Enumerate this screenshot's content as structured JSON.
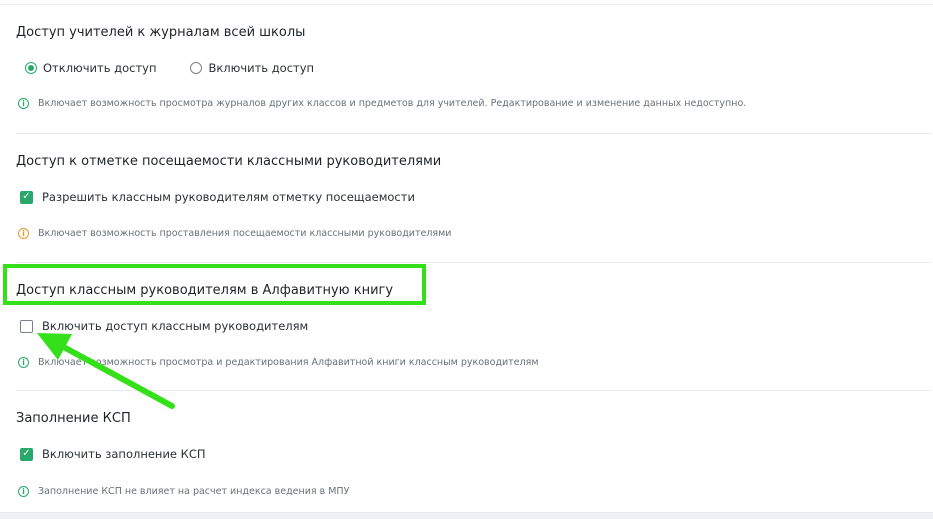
{
  "sections": [
    {
      "title": "Доступ учителей к журналам всей школы",
      "options": [
        {
          "label": "Отключить доступ",
          "selected": true
        },
        {
          "label": "Включить доступ",
          "selected": false
        }
      ],
      "hint": "Включает возможность просмотра журналов других классов и предметов для учителей. Редактирование и изменение данных недоступно.",
      "hint_icon": "info-icon"
    },
    {
      "title": "Доступ к отметке посещаемости классными руководителями",
      "checkbox": {
        "label": "Разрешить классным руководителям отметку посещаемости",
        "checked": true
      },
      "hint": "Включает возможность проставления посещаемости классными руководителями",
      "hint_icon": "warning-icon"
    },
    {
      "title": "Доступ классным руководителям в Алфавитную книгу",
      "checkbox": {
        "label": "Включить доступ классным руководителям",
        "checked": false
      },
      "hint": "Включает возможность просмотра и редактирования Алфавитной книги классным руководителям",
      "hint_icon": "info-icon"
    },
    {
      "title": "Заполнение КСП",
      "checkbox": {
        "label": "Включить заполнение КСП",
        "checked": true
      },
      "hint": "Заполнение КСП не влияет на расчет индекса ведения в МПУ",
      "hint_icon": "info-icon"
    }
  ],
  "colors": {
    "accent": "#2aa86b",
    "warning": "#e59a2c",
    "annotation": "#34e01a"
  }
}
